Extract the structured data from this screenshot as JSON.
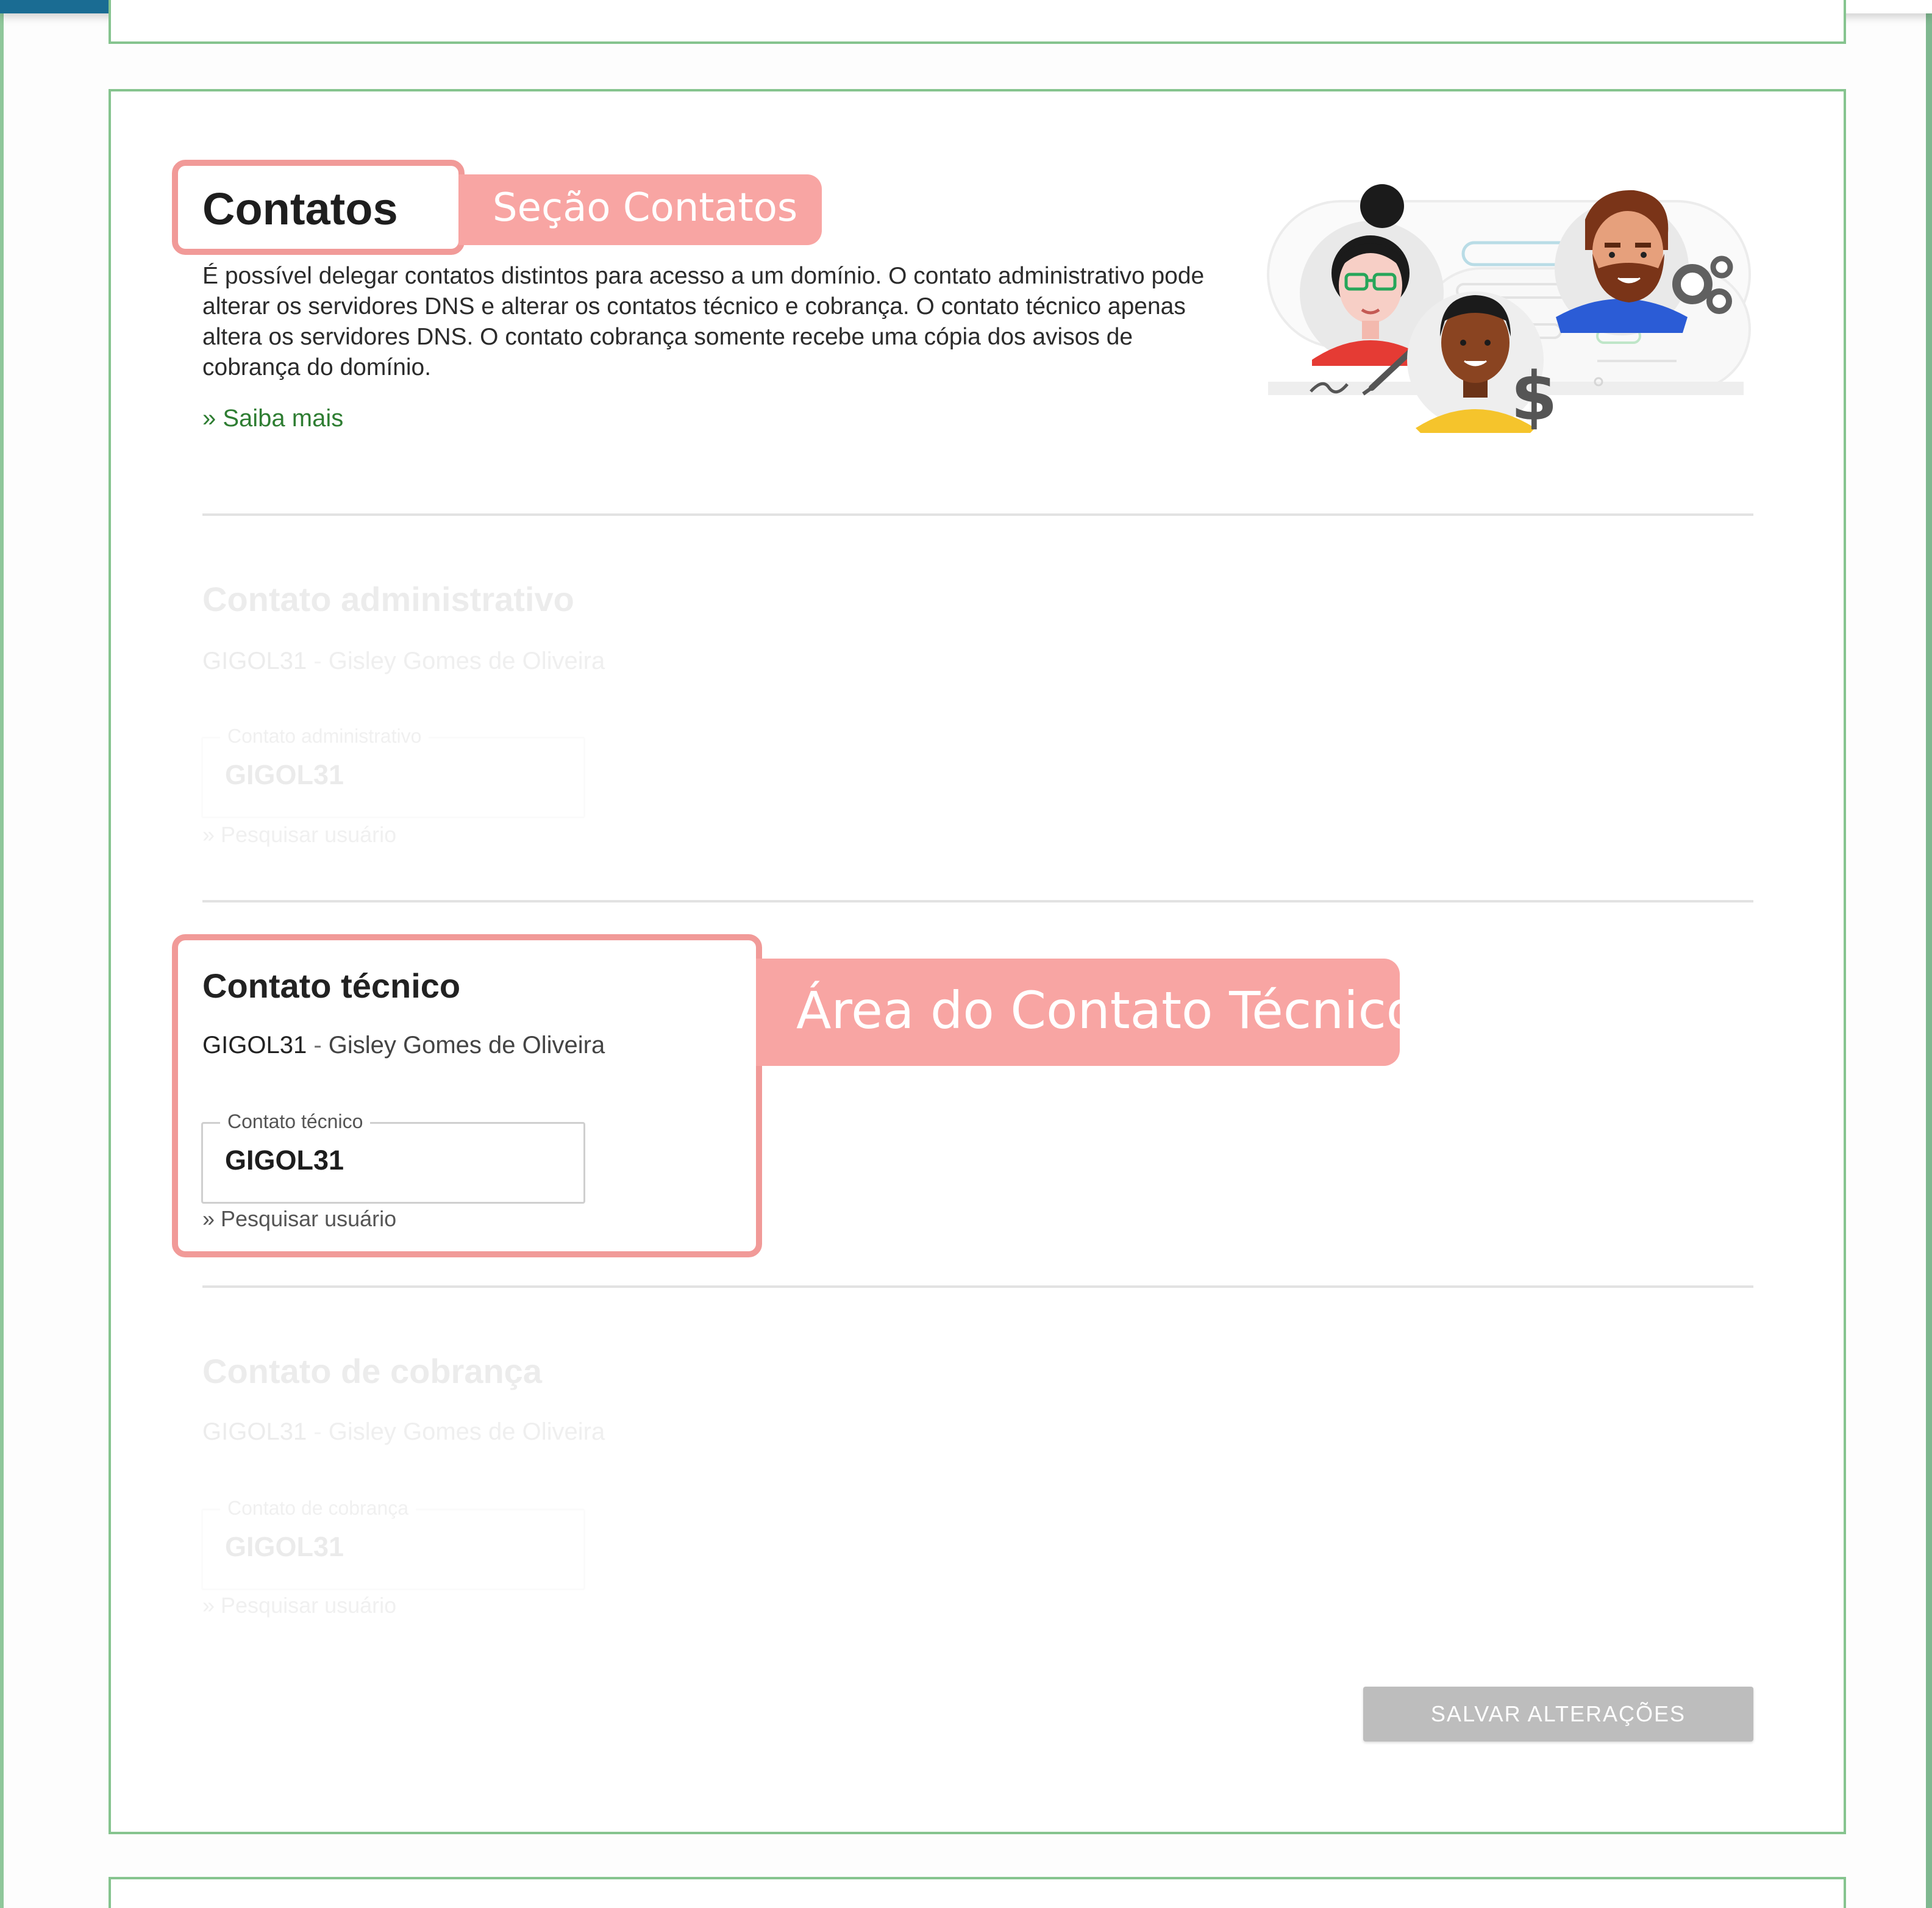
{
  "header": {
    "title": "Contatos",
    "section_callout": "Seção Contatos",
    "description": "É possível delegar contatos distintos para acesso a um domínio. O contato administrativo pode alterar os servidores DNS e alterar os contatos técnico e cobrança. O contato técnico apenas altera os servidores DNS. O contato cobrança somente recebe uma cópia dos avisos de cobrança do domínio.",
    "learn_more": "» Saiba mais"
  },
  "admin": {
    "heading": "Contato administrativo",
    "code": "GIGOL31",
    "separator": " - ",
    "name": "Gisley Gomes de Oliveira",
    "field_label": "Contato administrativo",
    "field_value": "GIGOL31",
    "search_link": "» Pesquisar usuário"
  },
  "technical": {
    "heading": "Contato técnico",
    "code": "GIGOL31",
    "separator": " - ",
    "name": "Gisley Gomes de Oliveira",
    "field_label": "Contato técnico",
    "field_value": "GIGOL31",
    "search_link": "» Pesquisar usuário",
    "area_callout": "Área do Contato Técnico"
  },
  "billing": {
    "heading": "Contato de cobrança",
    "code": "GIGOL31",
    "separator": " - ",
    "name": "Gisley Gomes de Oliveira",
    "field_label": "Contato de cobrança",
    "field_value": "GIGOL31",
    "search_link": "» Pesquisar usuário"
  },
  "actions": {
    "save_label": "SALVAR ALTERAÇÕES"
  },
  "colors": {
    "card_border": "#86c48f",
    "callout_bg": "#f8a5a3",
    "highlight_border": "#f19a98",
    "link_green": "#2e7d32",
    "top_accent": "#1a6c93",
    "button_disabled": "#bdbdbd"
  },
  "illustration": {
    "icons": [
      "woman-avatar-icon",
      "man-avatar-icon",
      "person-avatar-icon",
      "pen-icon",
      "dollar-icon",
      "gears-icon"
    ]
  }
}
